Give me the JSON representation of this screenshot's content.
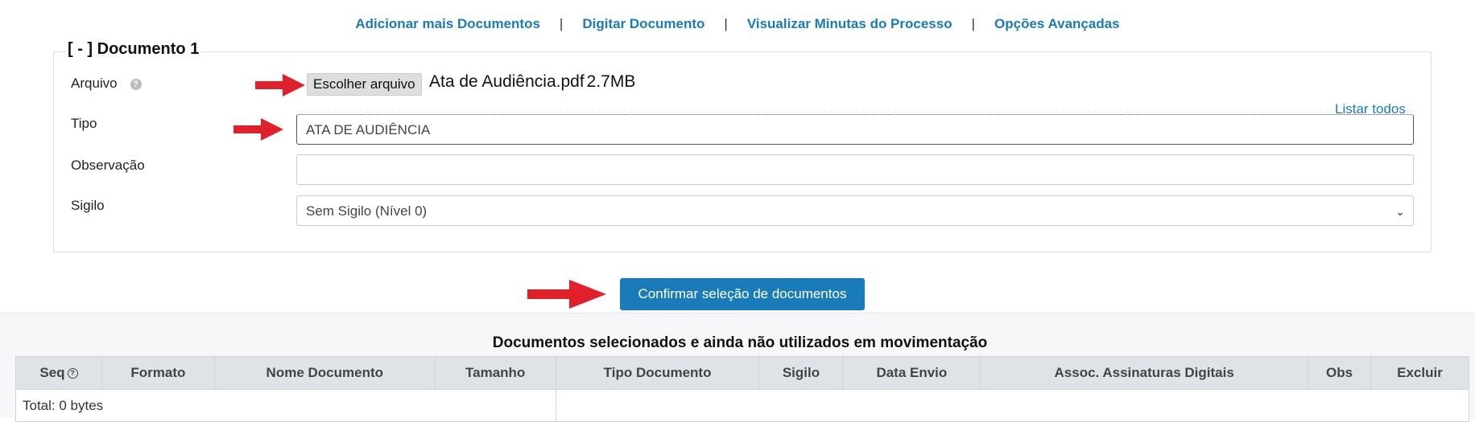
{
  "top_links": [
    {
      "label": "Adicionar mais Documentos"
    },
    {
      "label": "Digitar Documento"
    },
    {
      "label": "Visualizar Minutas do Processo"
    },
    {
      "label": "Opções Avançadas"
    }
  ],
  "separator": "|",
  "document": {
    "legend": "[ - ] Documento 1",
    "arquivo_label": "Arquivo",
    "help_glyph": "?",
    "choose_file_label": "Escolher arquivo",
    "file_name": "Ata de Audiência.pdf",
    "file_size": "2.7MB",
    "listar_todos": "Listar todos",
    "tipo_label": "Tipo",
    "tipo_value": "ATA DE AUDIÊNCIA",
    "observacao_label": "Observação",
    "observacao_value": "",
    "sigilo_label": "Sigilo",
    "sigilo_value": "Sem Sigilo (Nível 0)"
  },
  "confirm_button": "Confirmar seleção de documentos",
  "table": {
    "title": "Documentos selecionados e ainda não utilizados em movimentação",
    "columns": [
      "Seq",
      "Formato",
      "Nome Documento",
      "Tamanho",
      "Tipo Documento",
      "Sigilo",
      "Data Envio",
      "Assoc. Assinaturas Digitais",
      "Obs",
      "Excluir"
    ],
    "seq_help_glyph": "?",
    "total": "Total: 0 bytes"
  },
  "colors": {
    "accent": "#1a7bb9",
    "arrow": "#e0202a"
  }
}
